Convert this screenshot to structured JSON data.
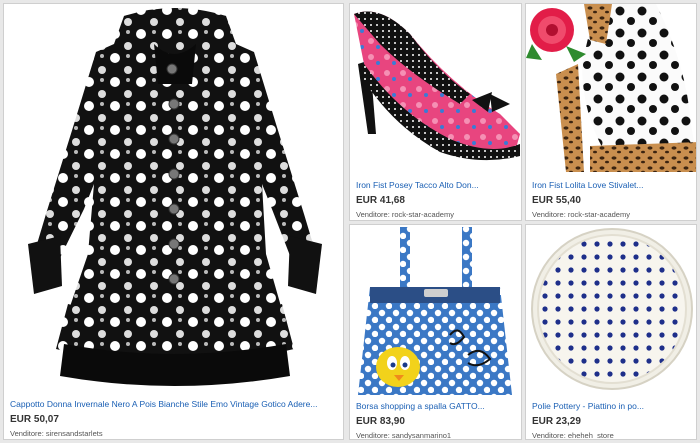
{
  "listings": [
    {
      "title": "Cappotto Donna Invernale Nero A Pois Bianche Stile Emo Vintage Gotico Adere...",
      "price": "EUR 50,07",
      "seller_label": "Venditore:",
      "seller": "sirensandstarlets",
      "image": "black-white-polka-dot-coat-image"
    },
    {
      "title": "Iron Fist Posey Tacco Alto Don...",
      "price": "EUR 41,68",
      "seller_label": "Venditore:",
      "seller": "rock-star-academy",
      "image": "pink-floral-polka-dot-heel-image"
    },
    {
      "title": "Iron Fist Lolita Love Stivalet...",
      "price": "EUR 55,40",
      "seller_label": "Venditore:",
      "seller": "rock-star-academy",
      "image": "polka-dot-boot-image"
    },
    {
      "title": "Borsa shopping a spalla GATTO...",
      "price": "EUR 83,90",
      "seller_label": "Venditore:",
      "seller": "sandysanmarino1",
      "image": "blue-polka-dot-tote-bag-image"
    },
    {
      "title": "Polie Pottery - Piattino in po...",
      "price": "EUR 23,29",
      "seller_label": "Venditore:",
      "seller": "eheheh_store",
      "image": "polka-dot-plate-image"
    }
  ]
}
